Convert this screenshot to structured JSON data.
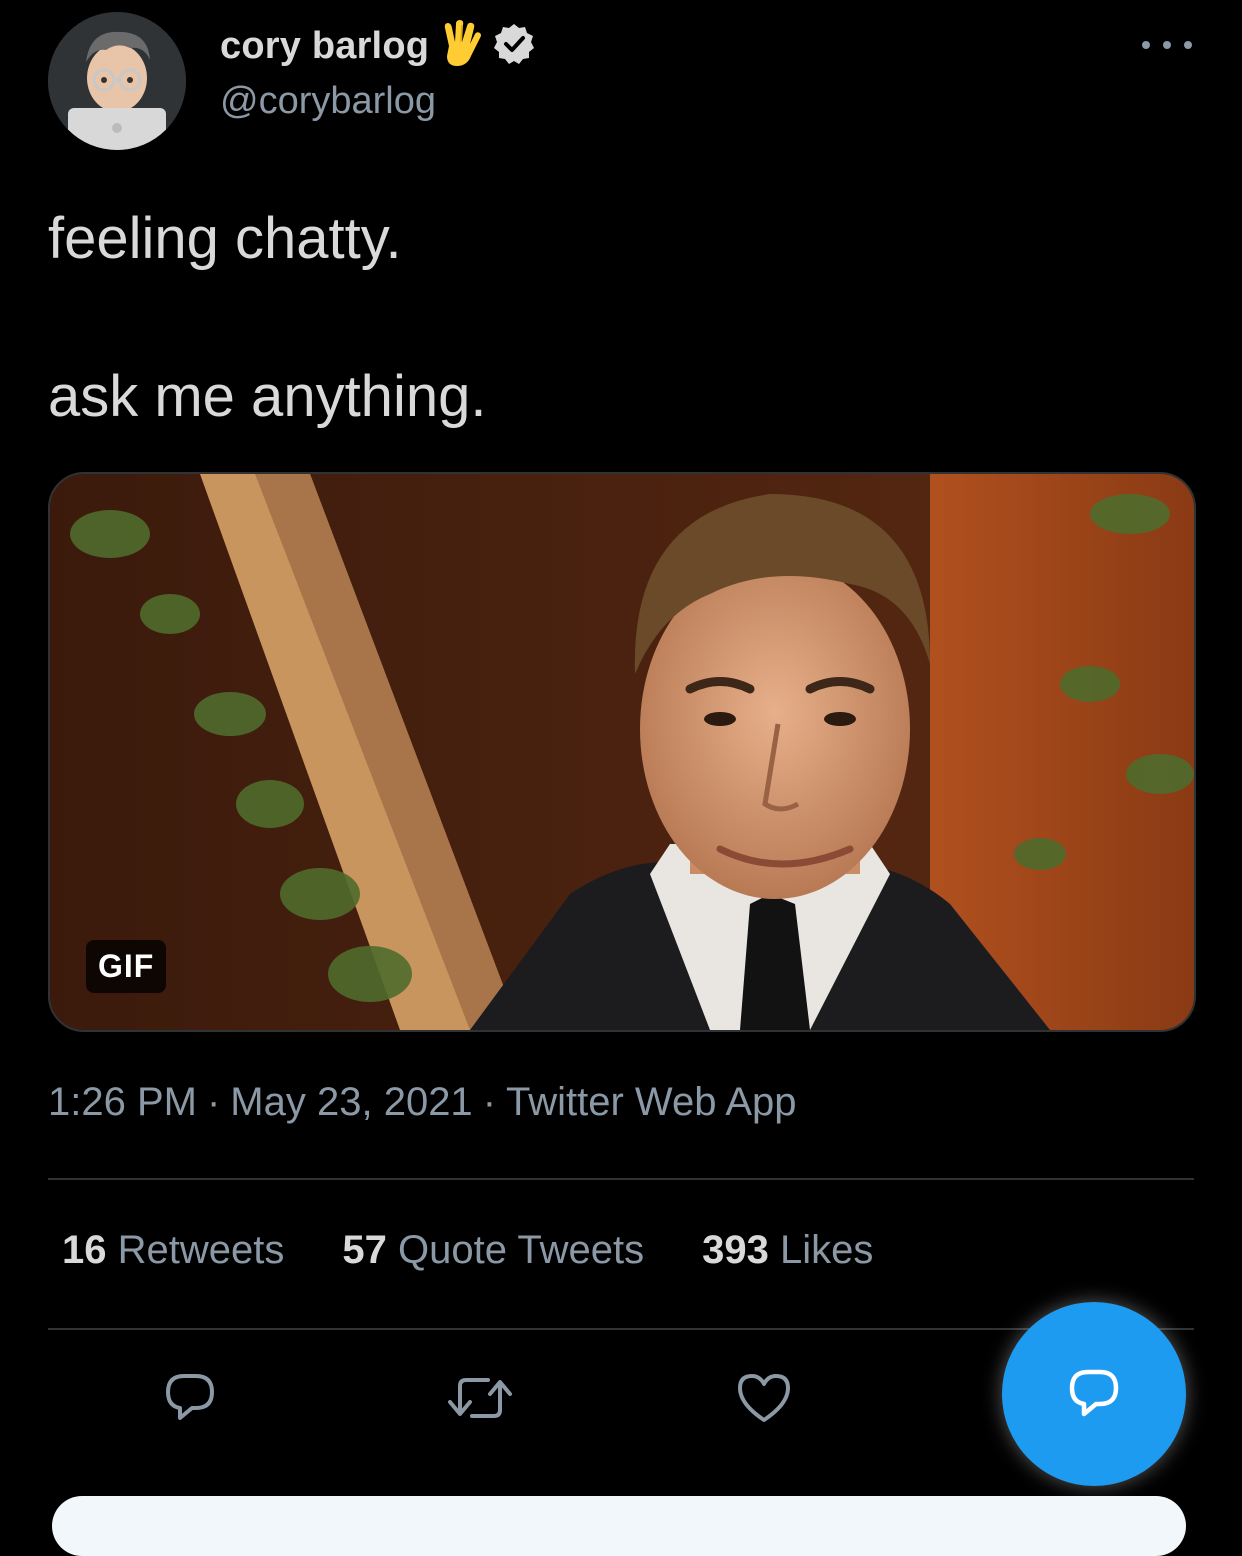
{
  "author": {
    "display_name": "cory barlog",
    "handle": "@corybarlog",
    "name_emoji": "vulcan-salute-emoji",
    "verified": true
  },
  "tweet": {
    "text_line_1": "feeling chatty.",
    "text_line_2": "ask me anything.",
    "media_type_badge": "GIF",
    "time": "1:26 PM",
    "separator": "·",
    "date": "May 23, 2021",
    "source": "Twitter Web App"
  },
  "stats": {
    "retweets_count": "16",
    "retweets_label": "Retweets",
    "quote_tweets_count": "57",
    "quote_tweets_label": "Quote Tweets",
    "likes_count": "393",
    "likes_label": "Likes"
  },
  "actions": {
    "icons": [
      "reply-icon",
      "retweet-icon",
      "like-icon"
    ],
    "fab_icon": "compose-reply-icon"
  },
  "colors": {
    "background": "#000000",
    "primary_text": "#d9d9d9",
    "secondary_text": "#8b98a5",
    "divider": "#2f3336",
    "accent": "#1d9bf0"
  }
}
